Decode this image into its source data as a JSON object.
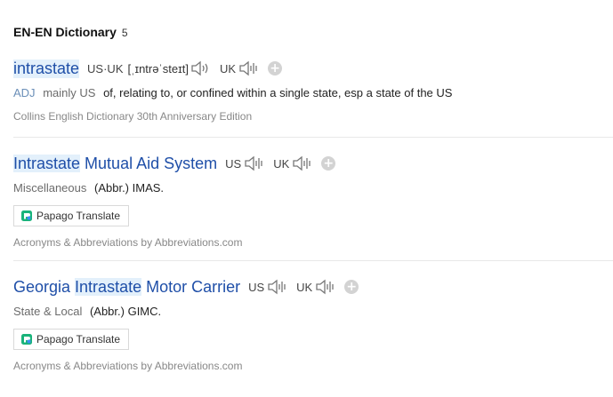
{
  "section": {
    "title": "EN-EN Dictionary",
    "count": "5"
  },
  "entries": [
    {
      "headword": "intrastate",
      "pron_us_uk_label": "US·UK",
      "ipa": "[ˌɪntrəˈsteɪt]",
      "uk_label": "UK",
      "pos": "ADJ",
      "usage": "mainly US",
      "definition": "of, relating to, or confined within a single state, esp a state of the US",
      "source": "Collins English Dictionary 30th Anniversary Edition"
    },
    {
      "headword_prefix": "",
      "headword_highlight": "Intrastate",
      "headword_suffix": " Mutual Aid System",
      "us_label": "US",
      "uk_label": "UK",
      "category": "Miscellaneous",
      "abbr": "(Abbr.) IMAS.",
      "translate_label": "Papago Translate",
      "source": "Acronyms & Abbreviations by Abbreviations.com"
    },
    {
      "headword_prefix": "Georgia ",
      "headword_highlight": "Intrastate",
      "headword_suffix": " Motor Carrier",
      "us_label": "US",
      "uk_label": "UK",
      "category": "State & Local",
      "abbr": "(Abbr.) GIMC.",
      "translate_label": "Papago Translate",
      "source": "Acronyms & Abbreviations by Abbreviations.com"
    }
  ],
  "colors": {
    "headword": "#1f4fa8",
    "highlight": "#e3f0fb",
    "pos": "#6b8fb8"
  },
  "icons": [
    "speaker-icon",
    "add-icon",
    "papago-icon"
  ]
}
